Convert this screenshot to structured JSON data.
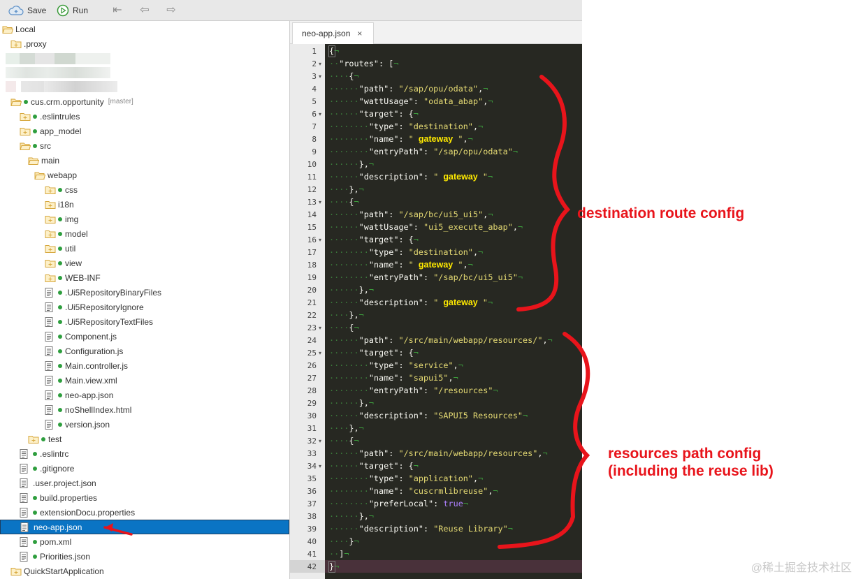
{
  "toolbar": {
    "save_label": "Save",
    "run_label": "Run"
  },
  "tree": [
    {
      "label": "Local",
      "icon": "folder-open-icon",
      "indent": 0,
      "status": false
    },
    {
      "label": ".proxy",
      "icon": "folder-icon",
      "indent": 1,
      "status": false
    },
    {
      "label": "cus.crm.opportunity",
      "icon": "folder-open-icon",
      "indent": 1,
      "status": true,
      "branch": "[master]"
    },
    {
      "label": ".eslintrules",
      "icon": "folder-icon",
      "indent": 2,
      "status": true
    },
    {
      "label": "app_model",
      "icon": "folder-icon",
      "indent": 2,
      "status": true
    },
    {
      "label": "src",
      "icon": "folder-open-icon",
      "indent": 2,
      "status": true
    },
    {
      "label": "main",
      "icon": "folder-open-icon",
      "indent": 3,
      "status": false
    },
    {
      "label": "webapp",
      "icon": "folder-open-icon",
      "indent": 4,
      "status": false
    },
    {
      "label": "css",
      "icon": "folder-icon",
      "indent": 5,
      "status": true
    },
    {
      "label": "i18n",
      "icon": "folder-icon",
      "indent": 5,
      "status": false
    },
    {
      "label": "img",
      "icon": "folder-icon",
      "indent": 5,
      "status": true
    },
    {
      "label": "model",
      "icon": "folder-icon",
      "indent": 5,
      "status": true
    },
    {
      "label": "util",
      "icon": "folder-icon",
      "indent": 5,
      "status": true
    },
    {
      "label": "view",
      "icon": "folder-icon",
      "indent": 5,
      "status": true
    },
    {
      "label": "WEB-INF",
      "icon": "folder-icon",
      "indent": 5,
      "status": true
    },
    {
      "label": ".Ui5RepositoryBinaryFiles",
      "icon": "file-icon",
      "indent": 5,
      "status": true
    },
    {
      "label": ".Ui5RepositoryIgnore",
      "icon": "file-icon",
      "indent": 5,
      "status": true
    },
    {
      "label": ".Ui5RepositoryTextFiles",
      "icon": "file-icon",
      "indent": 5,
      "status": true
    },
    {
      "label": "Component.js",
      "icon": "file-icon",
      "indent": 5,
      "status": true
    },
    {
      "label": "Configuration.js",
      "icon": "file-icon",
      "indent": 5,
      "status": true
    },
    {
      "label": "Main.controller.js",
      "icon": "file-icon",
      "indent": 5,
      "status": true
    },
    {
      "label": "Main.view.xml",
      "icon": "file-icon",
      "indent": 5,
      "status": true
    },
    {
      "label": "neo-app.json",
      "icon": "file-icon",
      "indent": 5,
      "status": true
    },
    {
      "label": "noShellIndex.html",
      "icon": "file-icon",
      "indent": 5,
      "status": true
    },
    {
      "label": "version.json",
      "icon": "file-icon",
      "indent": 5,
      "status": true
    },
    {
      "label": "test",
      "icon": "folder-icon",
      "indent": 3,
      "status": true
    },
    {
      "label": ".eslintrc",
      "icon": "file-icon",
      "indent": 2,
      "status": true
    },
    {
      "label": ".gitignore",
      "icon": "file-icon",
      "indent": 2,
      "status": true
    },
    {
      "label": ".user.project.json",
      "icon": "file-icon",
      "indent": 2,
      "status": false
    },
    {
      "label": "build.properties",
      "icon": "file-icon",
      "indent": 2,
      "status": true
    },
    {
      "label": "extensionDocu.properties",
      "icon": "file-icon",
      "indent": 2,
      "status": true
    },
    {
      "label": "neo-app.json",
      "icon": "file-icon",
      "indent": 2,
      "status": false,
      "selected": true
    },
    {
      "label": "pom.xml",
      "icon": "file-icon",
      "indent": 2,
      "status": true
    },
    {
      "label": "Priorities.json",
      "icon": "file-icon",
      "indent": 2,
      "status": true
    },
    {
      "label": "QuickStartApplication",
      "icon": "folder-icon",
      "indent": 1,
      "status": false
    }
  ],
  "editor": {
    "tab_label": "neo-app.json",
    "tab_close": "×",
    "active_line": 42,
    "lines": [
      "{",
      "  \"routes\": [",
      "    {",
      "      \"path\": \"/sap/opu/odata\",",
      "      \"wattUsage\": \"odata_abap\",",
      "      \"target\": {",
      "        \"type\": \"destination\",",
      "        \"name\": \" gateway \",",
      "        \"entryPath\": \"/sap/opu/odata\"",
      "      },",
      "      \"description\": \" gateway \"",
      "    },",
      "    {",
      "      \"path\": \"/sap/bc/ui5_ui5\",",
      "      \"wattUsage\": \"ui5_execute_abap\",",
      "      \"target\": {",
      "        \"type\": \"destination\",",
      "        \"name\": \" gateway \",",
      "        \"entryPath\": \"/sap/bc/ui5_ui5\"",
      "      },",
      "      \"description\": \" gateway \"",
      "    },",
      "    {",
      "      \"path\": \"/src/main/webapp/resources/\",",
      "      \"target\": {",
      "        \"type\": \"service\",",
      "        \"name\": \"sapui5\",",
      "        \"entryPath\": \"/resources\"",
      "      },",
      "      \"description\": \"SAPUI5 Resources\"",
      "    },",
      "    {",
      "      \"path\": \"/src/main/webapp/resources\",",
      "      \"target\": {",
      "        \"type\": \"application\",",
      "        \"name\": \"cuscrmlibreuse\",",
      "        \"preferLocal\": true",
      "      },",
      "      \"description\": \"Reuse Library\"",
      "    }",
      "  ]",
      "}"
    ],
    "fold_lines": [
      2,
      3,
      6,
      13,
      16,
      23,
      25,
      32,
      34
    ]
  },
  "annotations": {
    "destination": "destination route config",
    "resources": "resources path config\n(including the reuse lib)"
  },
  "colors": {
    "annotation": "#e8141b",
    "selection": "#0a74c4",
    "editor_bg": "#272822"
  },
  "watermark": "@稀土掘金技术社区"
}
